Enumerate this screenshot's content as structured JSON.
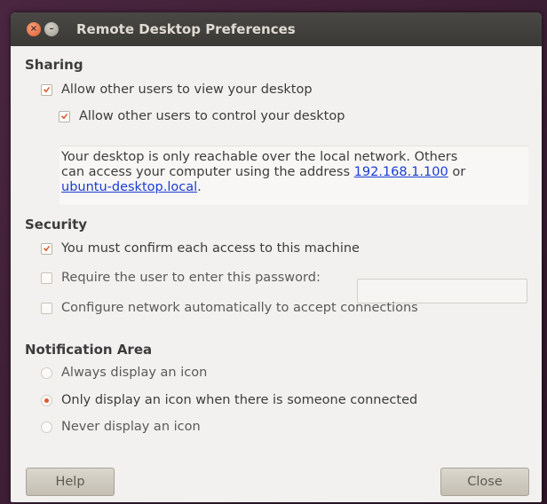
{
  "window": {
    "title": "Remote Desktop Preferences"
  },
  "sharing": {
    "heading": "Sharing",
    "allow_view": "Allow other users to view your desktop",
    "allow_control": "Allow other users to control your desktop",
    "info_line1": "Your desktop is only reachable over the local network. Others",
    "info_line2_pre": "can access your computer using the address ",
    "info_ip": "192.168.1.100",
    "info_or": " or",
    "info_host": "ubuntu-desktop.local",
    "info_period": "."
  },
  "security": {
    "heading": "Security",
    "confirm_access": "You must confirm each access to this machine",
    "require_password": "Require the user to enter this password:",
    "password_value": "",
    "configure_network": "Configure network automatically to accept connections"
  },
  "notification": {
    "heading": "Notification Area",
    "always": "Always display an icon",
    "only_connected": "Only display an icon when there is someone connected",
    "never": "Never display an icon"
  },
  "buttons": {
    "help": "Help",
    "close": "Close"
  },
  "colors": {
    "accent": "#d95b2a",
    "link": "#1c3cd4",
    "titlebar": "#3a3935"
  }
}
